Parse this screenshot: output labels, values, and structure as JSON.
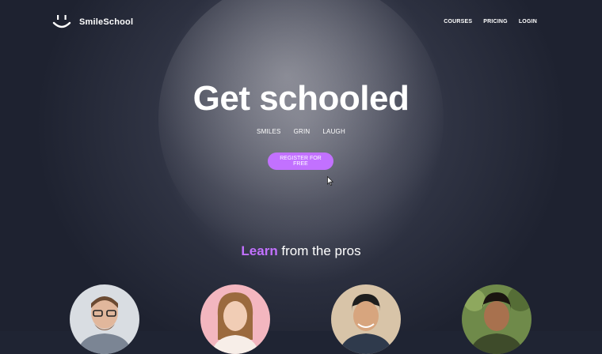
{
  "brand": {
    "name": "SmileSchool",
    "icon": "smiley-icon"
  },
  "nav": {
    "links": [
      "COURSES",
      "PRICING",
      "LOGIN"
    ]
  },
  "hero": {
    "headline": "Get schooled",
    "tags": [
      "SMILES",
      "GRIN",
      "LAUGH"
    ],
    "cta_label": "REGISTER FOR FREE"
  },
  "pros_section": {
    "accent": "Learn",
    "rest": " from the pros"
  },
  "colors": {
    "accent": "#c271ff",
    "background": "#23283a",
    "text": "#ffffff"
  },
  "avatars": [
    {
      "icon": "person-glasses-photo",
      "bg": "#d9dde2"
    },
    {
      "icon": "person-woman-photo",
      "bg": "#f3b6bf"
    },
    {
      "icon": "person-man-photo",
      "bg": "#d8c4a8"
    },
    {
      "icon": "person-man-outdoor-photo",
      "bg": "#6f8a4a"
    }
  ]
}
